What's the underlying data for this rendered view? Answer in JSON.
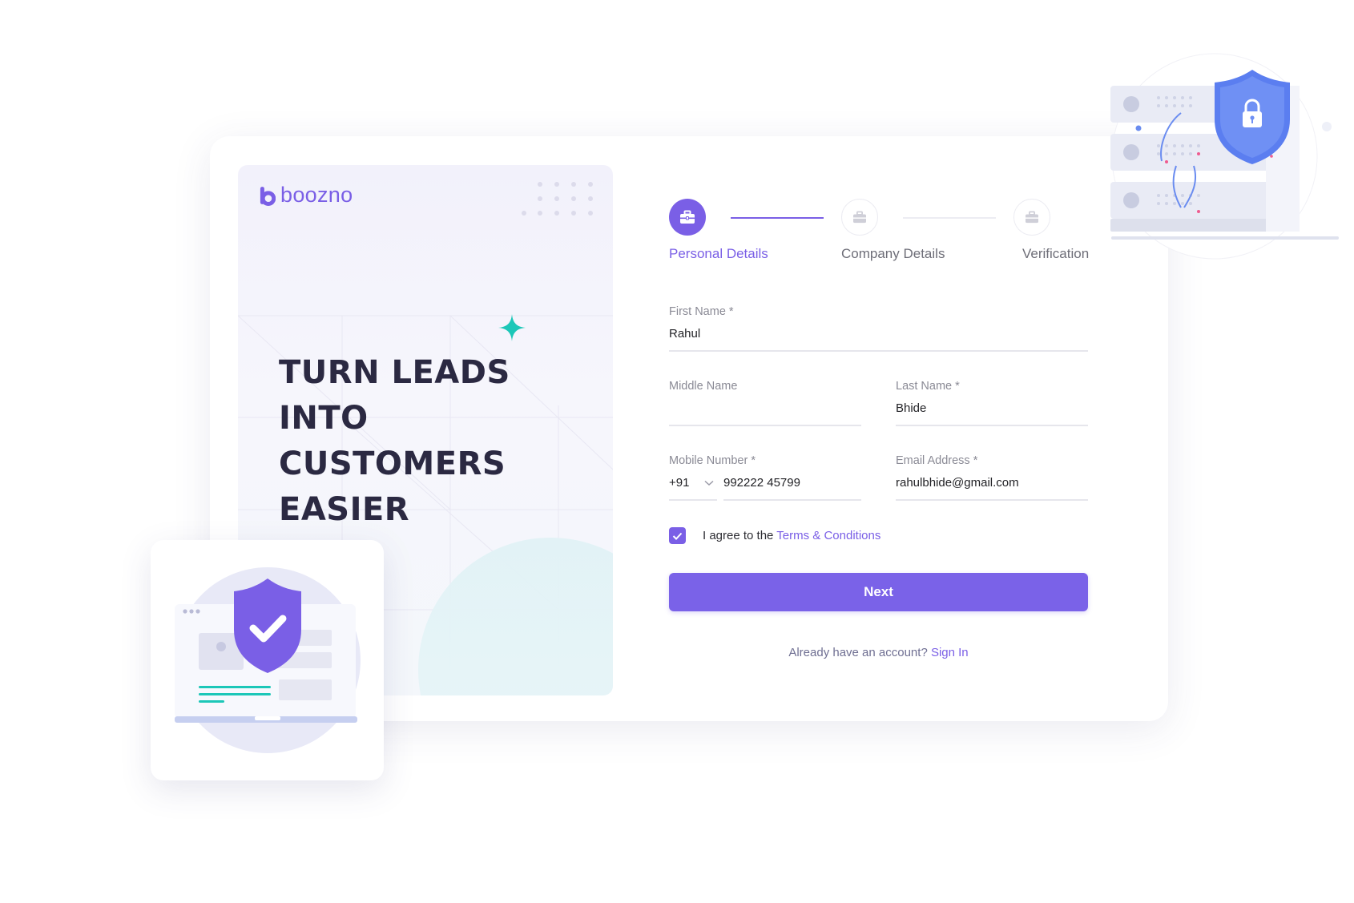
{
  "brand": {
    "name": "boozno",
    "color": "#7a5fe6"
  },
  "hero": {
    "lines": [
      "TURN LEADS",
      "INTO",
      "CUSTOMERS",
      "EASIER"
    ]
  },
  "stepper": {
    "steps": [
      {
        "label": "Personal Details",
        "state": "active",
        "icon": "briefcase-icon"
      },
      {
        "label": "Company Details",
        "state": "inactive",
        "icon": "briefcase-icon"
      },
      {
        "label": "Verification",
        "state": "inactive",
        "icon": "briefcase-icon"
      }
    ]
  },
  "form": {
    "first_name": {
      "label": "First Name *",
      "value": "Rahul"
    },
    "middle_name": {
      "label": "Middle Name",
      "value": ""
    },
    "last_name": {
      "label": "Last Name *",
      "value": "Bhide"
    },
    "mobile": {
      "label": "Mobile Number *",
      "country_code": "+91",
      "value": "992222 45799"
    },
    "email": {
      "label": "Email Address *",
      "value": "rahulbhide@gmail.com"
    },
    "agree": {
      "prefix": "I agree to the ",
      "link": "Terms & Conditions",
      "checked": true
    },
    "next_label": "Next",
    "signin": {
      "prefix": "Already have an account? ",
      "link": "Sign In"
    }
  },
  "colors": {
    "accent": "#7a5fe6",
    "teal": "#1cc7b8",
    "text_dark": "#2b2942"
  }
}
